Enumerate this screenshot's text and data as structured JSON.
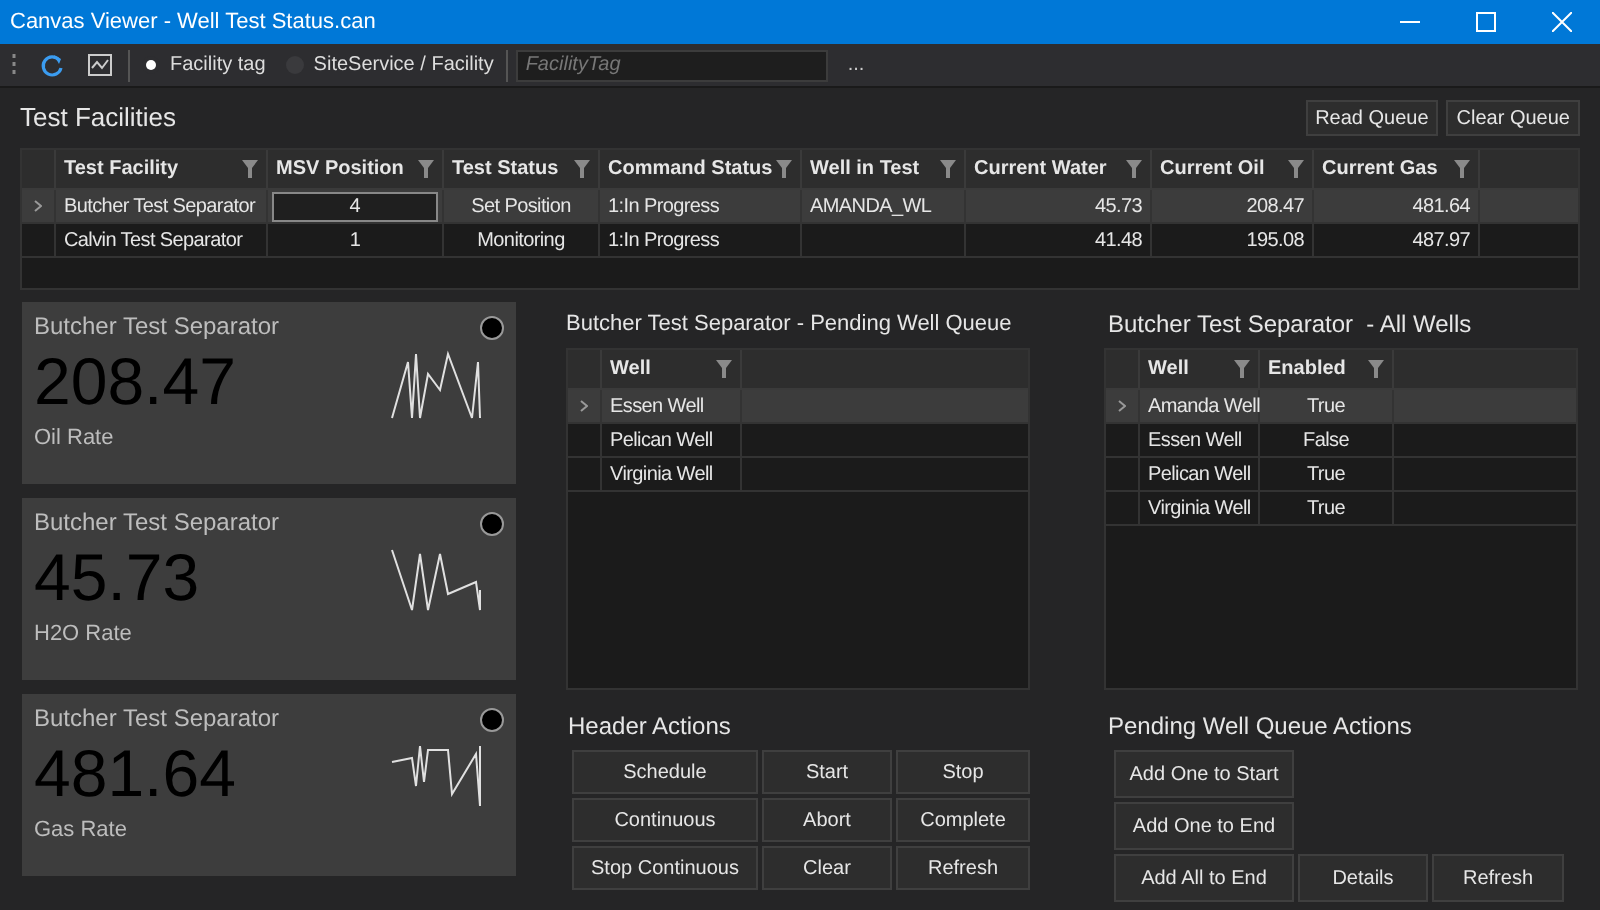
{
  "window": {
    "title": "Canvas Viewer - Well Test Status.can"
  },
  "toolbar": {
    "options": [
      {
        "label": "Facility tag",
        "selected": true
      },
      {
        "label": "SiteService / Facility",
        "selected": false
      }
    ],
    "search": {
      "placeholder": "FacilityTag"
    },
    "browse_button": "..."
  },
  "test_facilities": {
    "title": "Test Facilities",
    "buttons": [
      "Read Queue",
      "Clear Queue"
    ],
    "columns": [
      "Test Facility",
      "MSV Position",
      "Test Status",
      "Command Status",
      "Well in Test",
      "Current Water",
      "Current Oil",
      "Current Gas"
    ],
    "rows": [
      {
        "selected": true,
        "cells": [
          "Butcher Test Separator",
          "4",
          "Set Position",
          "1:In Progress",
          "AMANDA_WL",
          "45.73",
          "208.47",
          "481.64"
        ]
      },
      {
        "selected": false,
        "cells": [
          "Calvin Test Separator",
          "1",
          "Monitoring",
          "1:In Progress",
          "",
          "41.48",
          "195.08",
          "487.97"
        ]
      }
    ]
  },
  "cards": [
    {
      "title": "Butcher Test Separator",
      "value": "208.47",
      "label": "Oil Rate"
    },
    {
      "title": "Butcher Test Separator",
      "value": "45.73",
      "label": "H2O Rate"
    },
    {
      "title": "Butcher Test Separator",
      "value": "481.64",
      "label": "Gas Rate"
    }
  ],
  "pending_queue": {
    "title": "Butcher Test Separator - Pending Well Queue",
    "columns": [
      "Well"
    ],
    "rows": [
      {
        "selected": true,
        "cells": [
          "Essen Well"
        ]
      },
      {
        "selected": false,
        "cells": [
          "Pelican Well"
        ]
      },
      {
        "selected": false,
        "cells": [
          "Virginia Well"
        ]
      }
    ]
  },
  "all_wells": {
    "title": "Butcher Test Separator  - All Wells",
    "columns": [
      "Well",
      "Enabled"
    ],
    "rows": [
      {
        "selected": true,
        "cells": [
          "Amanda Well",
          "True"
        ]
      },
      {
        "selected": false,
        "cells": [
          "Essen Well",
          "False"
        ]
      },
      {
        "selected": false,
        "cells": [
          "Pelican Well",
          "True"
        ]
      },
      {
        "selected": false,
        "cells": [
          "Virginia Well",
          "True"
        ]
      }
    ]
  },
  "header_actions": {
    "title": "Header Actions",
    "buttons": [
      "Schedule",
      "Start",
      "Stop",
      "Continuous",
      "Abort",
      "Complete",
      "Stop Continuous",
      "Clear",
      "Refresh"
    ]
  },
  "queue_actions": {
    "title": "Pending Well Queue Actions",
    "buttons": [
      "Add One to Start",
      "Add One to End",
      "Add All to End",
      "Details",
      "Refresh"
    ]
  }
}
